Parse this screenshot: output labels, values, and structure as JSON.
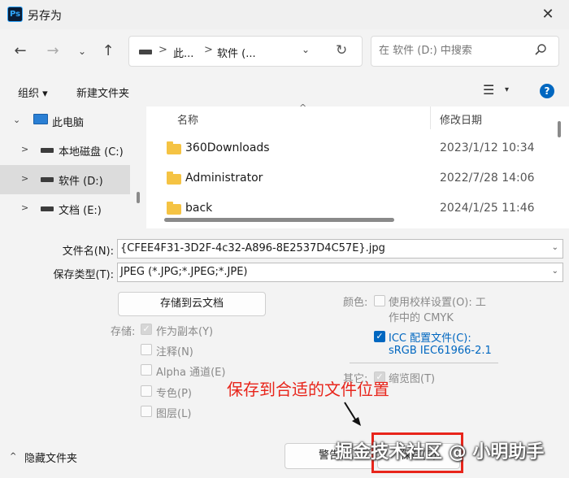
{
  "window": {
    "title": "另存为",
    "app_icon": "Ps",
    "close_glyph": "✕"
  },
  "nav": {
    "back_glyph": "←",
    "forward_glyph": "→",
    "history_glyph": "⌄",
    "up_glyph": "↑",
    "address": {
      "segments": [
        "此...",
        "软件 (..."
      ],
      "separator": ">",
      "dropdown_glyph": "⌄",
      "refresh_glyph": "↻"
    },
    "search": {
      "placeholder": "在 软件 (D:) 中搜索",
      "value": ""
    }
  },
  "toolbar": {
    "organize_label": "组织 ▾",
    "new_folder_label": "新建文件夹",
    "view_glyph": "☰",
    "view_dropdown_glyph": "▾",
    "help_glyph": "?"
  },
  "sidebar": {
    "items": [
      {
        "label": "此电脑",
        "chevron": "⌄"
      },
      {
        "label": "本地磁盘 (C:)",
        "chevron": ">"
      },
      {
        "label": "软件 (D:)",
        "chevron": ">"
      },
      {
        "label": "文档 (E:)",
        "chevron": ">"
      }
    ]
  },
  "files": {
    "columns": {
      "name": "名称",
      "date": "修改日期",
      "sort_glyph": "^"
    },
    "rows": [
      {
        "name": "360Downloads",
        "date": "2023/1/12 10:34"
      },
      {
        "name": "Administrator",
        "date": "2022/7/28 14:06"
      },
      {
        "name": "back",
        "date": "2024/1/25 11:46"
      }
    ]
  },
  "form": {
    "filename_label": "文件名(N):",
    "filename_value": "{CFEE4F31-3D2F-4c32-A896-8E2537D4C57E}.jpg",
    "filetype_label": "保存类型(T):",
    "filetype_value": "JPEG (*.JPG;*.JPEG;*.JPE)",
    "dropdown_glyph": "⌄",
    "cloud_button": "存储到云文档",
    "storage_label": "存储:",
    "storage_options": [
      {
        "label": "作为副本(Y)",
        "checked": true
      },
      {
        "label": "注释(N)",
        "checked": false
      },
      {
        "label": "Alpha 通道(E)",
        "checked": false
      },
      {
        "label": "专色(P)",
        "checked": false
      },
      {
        "label": "图层(L)",
        "checked": false
      }
    ],
    "color_label": "颜色:",
    "proof_setup_line1": "使用校样设置(O):  工",
    "proof_setup_line2": "作中的 CMYK",
    "icc_label": "ICC 配置文件(C):",
    "icc_profile": "sRGB IEC61966-2.1",
    "other_label": "其它:",
    "thumbnail_label": "缩览图(T)",
    "check_glyph": "✓"
  },
  "annotation": {
    "text": "保存到合适的文件位置",
    "color": "#e8251b"
  },
  "bottom": {
    "hide_folders_label": "隐藏文件夹",
    "hide_chevron": "^",
    "warning_button": "警告",
    "save_button": "保存(S)"
  },
  "watermark": "掘金技术社区 @ 小明助手"
}
